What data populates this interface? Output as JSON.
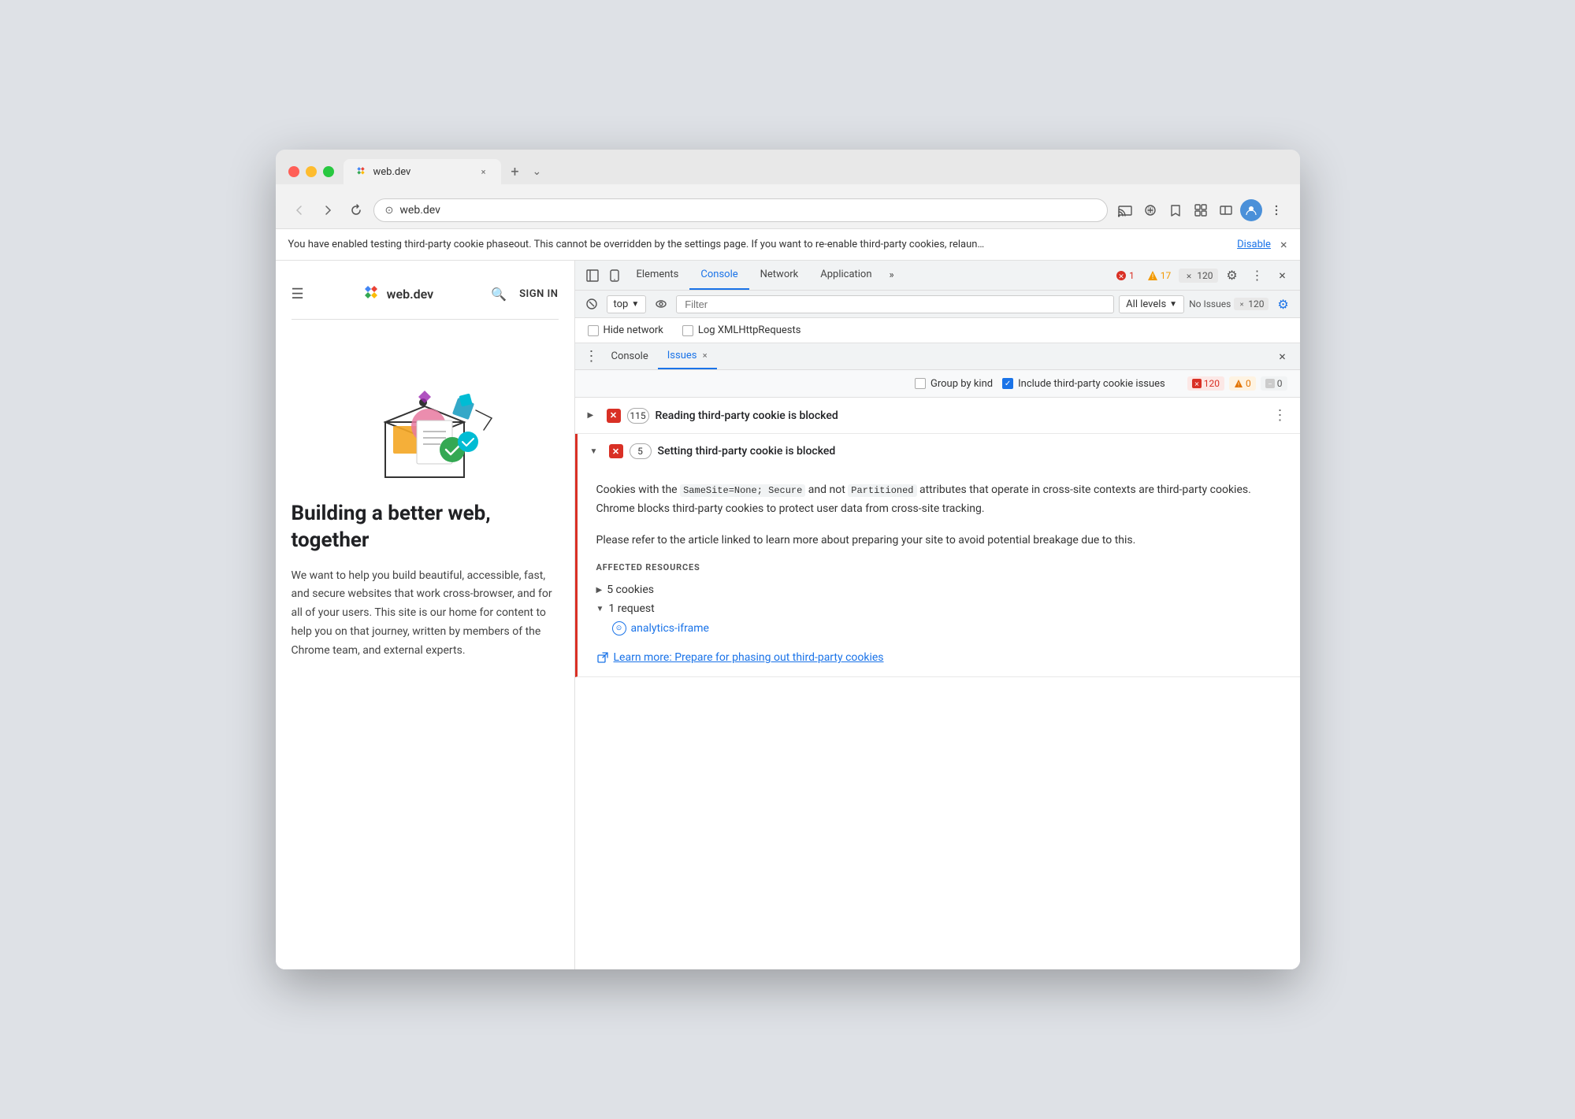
{
  "browser": {
    "tab_title": "web.dev",
    "tab_url": "web.dev",
    "new_tab_label": "+",
    "dropdown_arrow": "⌄"
  },
  "nav": {
    "back_title": "Back",
    "forward_title": "Forward",
    "reload_title": "Reload",
    "address": "web.dev",
    "address_icon": "🔒"
  },
  "info_bar": {
    "text": "You have enabled testing third-party cookie phaseout. This cannot be overridden by the settings page. If you want to re-enable third-party cookies, relaun…",
    "link": "Disable",
    "close": "×"
  },
  "website": {
    "logo_text": "web.dev",
    "sign_in": "SIGN IN",
    "headline": "Building a better web, together",
    "body_text": "We want to help you build beautiful, accessible, fast, and secure websites that work cross-browser, and for all of your users. This site is our home for content to help you on that journey, written by members of the Chrome team, and external experts."
  },
  "devtools": {
    "tabs": [
      {
        "id": "elements",
        "label": "Elements",
        "active": false
      },
      {
        "id": "console",
        "label": "Console",
        "active": false
      },
      {
        "id": "network",
        "label": "Network",
        "active": false
      },
      {
        "id": "application",
        "label": "Application",
        "active": false
      },
      {
        "id": "more",
        "label": "»",
        "active": false
      }
    ],
    "badge_red_count": "1",
    "badge_yellow_count": "17",
    "badge_gray_count": "120",
    "close_label": "×",
    "console_toolbar": {
      "context_label": "top",
      "filter_placeholder": "Filter",
      "level_label": "All levels",
      "no_issues_label": "No Issues",
      "no_issues_count": "120"
    },
    "checkbox_row": {
      "hide_network": "Hide network",
      "log_xmlhttp": "Log XMLHttpRequests"
    },
    "subtabs": {
      "console_label": "Console",
      "issues_label": "Issues",
      "close_label": "×"
    },
    "issues_filter": {
      "group_by_kind": "Group by kind",
      "include_third_party": "Include third-party cookie issues",
      "count_red": "120",
      "count_orange": "0",
      "count_gray": "0"
    },
    "issues": [
      {
        "id": "reading-cookie",
        "expanded": false,
        "icon": "✕",
        "count": "115",
        "title": "Reading third-party cookie is blocked"
      },
      {
        "id": "setting-cookie",
        "expanded": true,
        "icon": "✕",
        "count": "5",
        "title": "Setting third-party cookie is blocked",
        "description_parts": [
          "Cookies with the ",
          "SameSite=None; Secure",
          " and not ",
          "Partitioned",
          " attributes that operate in cross-site contexts are third-party cookies. Chrome blocks third-party cookies to protect user data from cross-site tracking."
        ],
        "description2": "Please refer to the article linked to learn more about preparing your site to avoid potential breakage due to this.",
        "affected_label": "AFFECTED RESOURCES",
        "cookies_item": "5 cookies",
        "request_item": "1 request",
        "request_link": "analytics-iframe",
        "learn_more_text": "Learn more: Prepare for phasing out third-party cookies",
        "learn_more_href": "#"
      }
    ]
  }
}
